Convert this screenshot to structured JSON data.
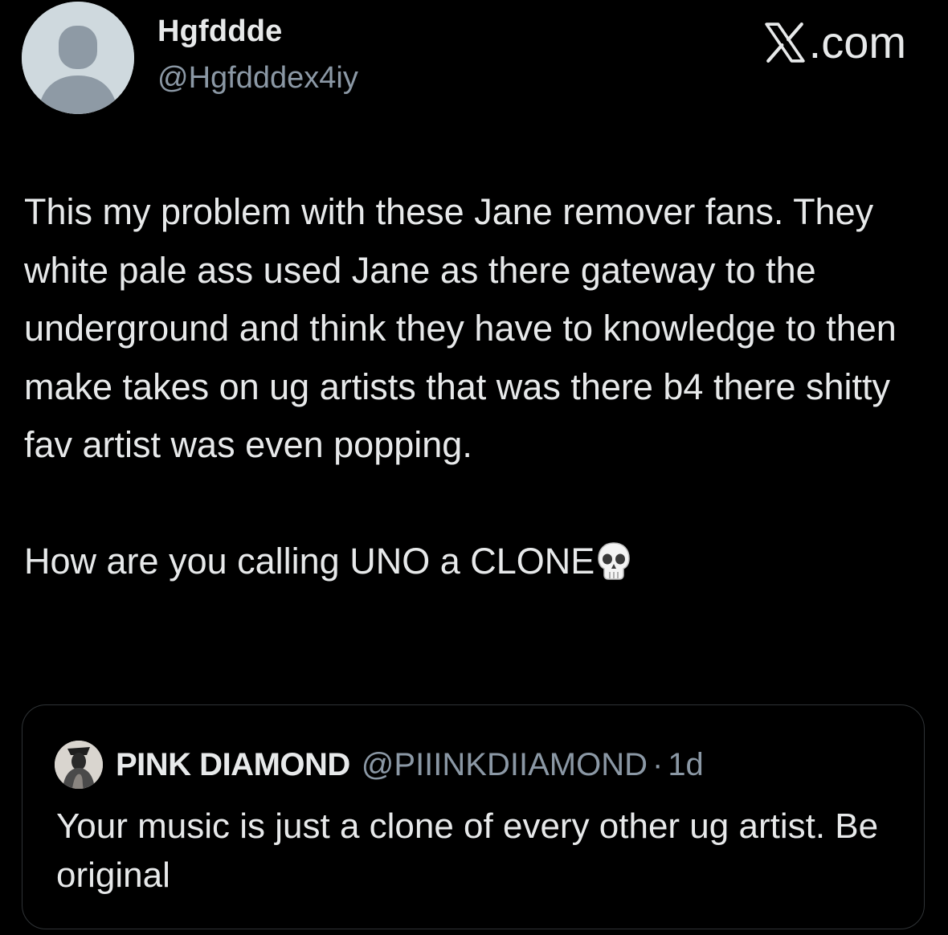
{
  "author": {
    "display_name": "Hgfddde",
    "handle": "@Hgfdddex4iy",
    "avatar_icon": "default-avatar-icon"
  },
  "brand": {
    "label": ".com",
    "logo_icon": "x-logo-icon"
  },
  "tweet": {
    "paragraph_1": "This my problem with these Jane remover fans. They white pale ass used Jane as there gateway to the underground and think they have to knowledge to then make takes on ug artists that was there b4 there shitty fav artist was even popping.",
    "paragraph_2": "How are you calling UNO a CLONE",
    "emoji_icon": "skull-icon"
  },
  "quoted_tweet": {
    "display_name": "PINK DIAMOND",
    "handle": "@PIIINKDIIAMOND",
    "separator": "·",
    "time": "1d",
    "text": "Your music is just a clone of every other ug artist. Be original",
    "avatar_icon": "profile-photo-icon"
  },
  "colors": {
    "background": "#000000",
    "primary_text": "#e7e9ea",
    "secondary_text": "#8b98a5",
    "border": "#2f3336",
    "avatar_bg": "#cfd9de",
    "avatar_fg": "#8e9aa5"
  }
}
